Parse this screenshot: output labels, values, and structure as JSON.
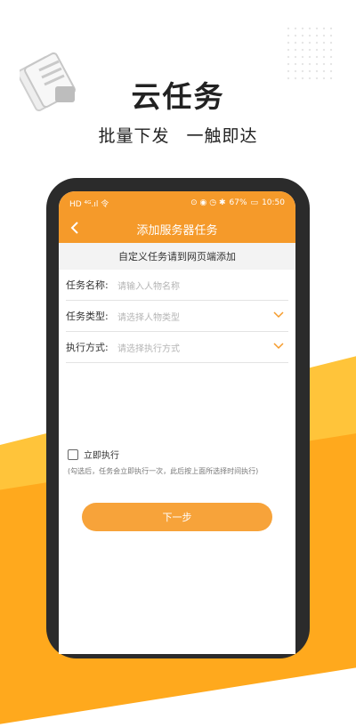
{
  "hero": {
    "title": "云任务",
    "subtitle_left": "批量下发",
    "subtitle_right": "一触即达"
  },
  "status_bar": {
    "left": "HD ⁴ᴳ.ıl 令",
    "battery": "67%",
    "time": "10:50"
  },
  "header": {
    "title": "添加服务器任务"
  },
  "notice": "自定义任务请到网页端添加",
  "form": {
    "task_name_label": "任务名称:",
    "task_name_placeholder": "请输入人物名称",
    "task_type_label": "任务类型:",
    "task_type_placeholder": "请选择人物类型",
    "exec_mode_label": "执行方式:",
    "exec_mode_placeholder": "请选择执行方式"
  },
  "immediate": {
    "label": "立即执行",
    "hint": "(勾选后，任务会立即执行一次，此后按上面所选择时间执行)"
  },
  "next_button": "下一步",
  "colors": {
    "accent": "#f59a2a",
    "button": "#f7a33a",
    "wave_light": "#ffc43a",
    "wave_dark": "#ffa91d"
  }
}
